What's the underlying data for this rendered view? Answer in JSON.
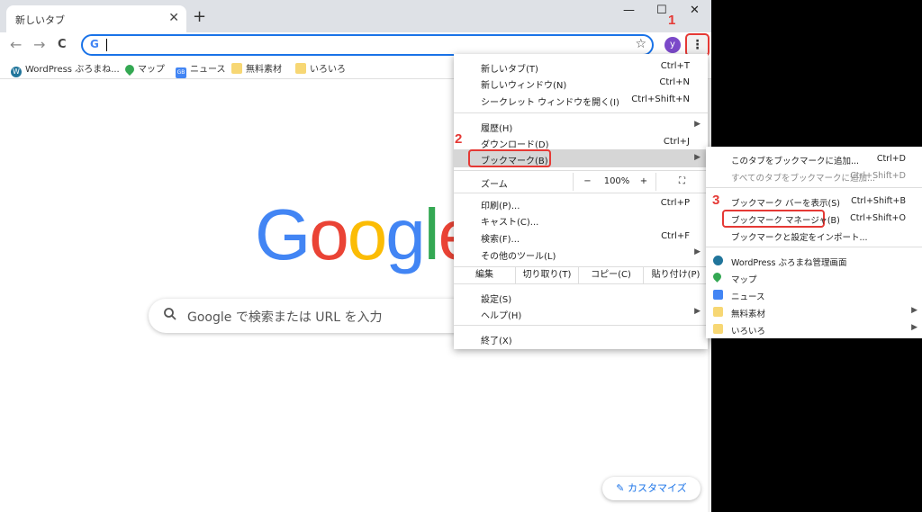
{
  "tab": {
    "title": "新しいタブ",
    "close": "✕",
    "new_tab": "+"
  },
  "window": {
    "minimize": "—",
    "maximize": "☐",
    "close": "✕"
  },
  "toolbar": {
    "back": "←",
    "forward": "→",
    "reload": "C",
    "omnibox_icon": "G",
    "omnibox_value": "",
    "star": "☆",
    "profile_initial": "y",
    "menu": "⋮"
  },
  "bookmarks_bar": [
    {
      "label": "WordPress ぶろまね...",
      "icon": "wordpress-icon"
    },
    {
      "label": "マップ",
      "icon": "maps-icon"
    },
    {
      "label": "ニュース",
      "icon": "news-icon"
    },
    {
      "label": "無料素材",
      "icon": "folder-icon"
    },
    {
      "label": "いろいろ",
      "icon": "folder-icon"
    }
  ],
  "page": {
    "logo_letters": [
      {
        "ch": "G",
        "color": "#4285f4"
      },
      {
        "ch": "o",
        "color": "#ea4335"
      },
      {
        "ch": "o",
        "color": "#fbbc05"
      },
      {
        "ch": "g",
        "color": "#4285f4"
      },
      {
        "ch": "l",
        "color": "#34a853"
      },
      {
        "ch": "e",
        "color": "#ea4335"
      }
    ],
    "search_placeholder": "Google で検索または URL を入力",
    "customize": "カスタマイズ"
  },
  "main_menu": {
    "new_tab": {
      "label": "新しいタブ(T)",
      "shortcut": "Ctrl+T"
    },
    "new_window": {
      "label": "新しいウィンドウ(N)",
      "shortcut": "Ctrl+N"
    },
    "incognito": {
      "label": "シークレット ウィンドウを開く(I)",
      "shortcut": "Ctrl+Shift+N"
    },
    "history": {
      "label": "履歴(H)"
    },
    "downloads": {
      "label": "ダウンロード(D)",
      "shortcut": "Ctrl+J"
    },
    "bookmarks": {
      "label": "ブックマーク(B)"
    },
    "zoom": {
      "label": "ズーム",
      "minus": "−",
      "value": "100%",
      "plus": "+",
      "fullscreen": "⛶"
    },
    "print": {
      "label": "印刷(P)...",
      "shortcut": "Ctrl+P"
    },
    "cast": {
      "label": "キャスト(C)..."
    },
    "find": {
      "label": "検索(F)...",
      "shortcut": "Ctrl+F"
    },
    "more_tools": {
      "label": "その他のツール(L)"
    },
    "edit": {
      "label": "編集",
      "cut": "切り取り(T)",
      "copy": "コピー(C)",
      "paste": "貼り付け(P)"
    },
    "settings": {
      "label": "設定(S)"
    },
    "help": {
      "label": "ヘルプ(H)"
    },
    "exit": {
      "label": "終了(X)"
    }
  },
  "bookmark_submenu": {
    "add_this": {
      "label": "このタブをブックマークに追加...",
      "shortcut": "Ctrl+D"
    },
    "add_all": {
      "label": "すべてのタブをブックマークに追加...",
      "shortcut": "Ctrl+Shift+D"
    },
    "show_bar": {
      "label": "ブックマーク バーを表示(S)",
      "shortcut": "Ctrl+Shift+B"
    },
    "manager": {
      "label": "ブックマーク マネージャ(B)",
      "shortcut": "Ctrl+Shift+O"
    },
    "import": {
      "label": "ブックマークと設定をインポート..."
    },
    "items": [
      {
        "label": "WordPress ぶろまね管理画面",
        "icon": "wordpress-icon"
      },
      {
        "label": "マップ",
        "icon": "maps-icon"
      },
      {
        "label": "ニュース",
        "icon": "news-icon"
      },
      {
        "label": "無料素材",
        "icon": "folder-icon"
      },
      {
        "label": "いろいろ",
        "icon": "folder-icon"
      }
    ]
  },
  "steps": [
    "1",
    "2",
    "3"
  ],
  "colors": {
    "accent": "#1a73e8",
    "highlight_red": "#e53935",
    "folder": "#f7d774"
  }
}
